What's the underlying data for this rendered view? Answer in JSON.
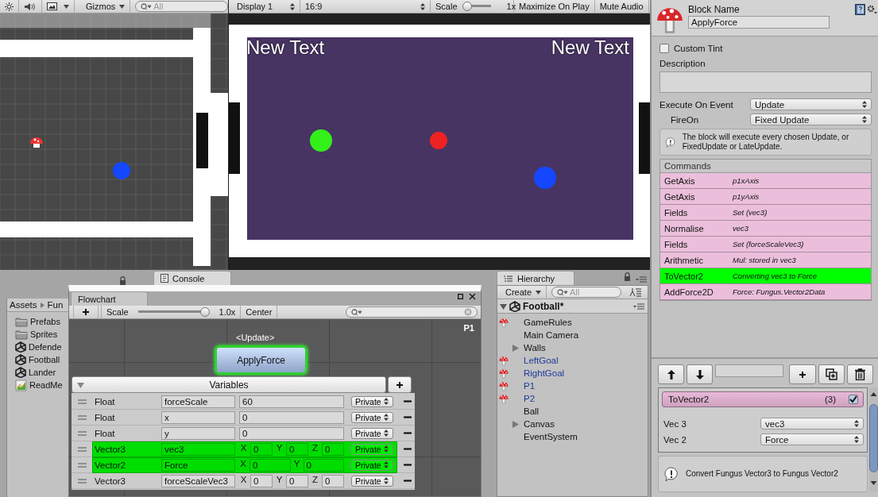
{
  "scene_view": {
    "toolbar": {
      "gizmos": "Gizmos",
      "search": {
        "placeholder": "All"
      }
    }
  },
  "game_view": {
    "toolbar": {
      "display": "Display 1",
      "aspect": "16:9",
      "scale_label": "Scale",
      "scale_reading": "1x",
      "toggles": [
        {
          "label": "Maximize On Play",
          "on": false
        },
        {
          "label": "Mute Audio",
          "on": false
        }
      ]
    },
    "texts": [
      "New Text",
      "New Text"
    ]
  },
  "console_tab": "Console",
  "project": {
    "breadcrumb": [
      "Assets",
      "Fun"
    ],
    "items": [
      {
        "kind": "folder",
        "label": "Prefabs"
      },
      {
        "kind": "folder",
        "label": "Sprites"
      },
      {
        "kind": "scene",
        "label": "Defende"
      },
      {
        "kind": "scene",
        "label": "Football"
      },
      {
        "kind": "scene",
        "label": "Lander"
      },
      {
        "kind": "text",
        "label": "ReadMe"
      }
    ]
  },
  "flowchart": {
    "tab": "Flowchart",
    "toolbar": {
      "scale_label": "Scale",
      "scale": {
        "level": 1.0
      },
      "scale_reading": "1.0x",
      "center_button": "Center"
    },
    "canvas_label": "P1",
    "block": {
      "event": "<Update>",
      "name": "ApplyForce",
      "selected": true
    },
    "variables": {
      "title": "Variables",
      "expanded": true,
      "rows": [
        {
          "kind": "scalar",
          "type": "Float",
          "name": "forceScale",
          "value": "60",
          "access": "Private",
          "highlighted": false
        },
        {
          "kind": "scalar",
          "type": "Float",
          "name": "x",
          "value": "0",
          "access": "Private",
          "highlighted": false
        },
        {
          "kind": "scalar",
          "type": "Float",
          "name": "y",
          "value": "0",
          "access": "Private",
          "highlighted": false
        },
        {
          "kind": "vector",
          "type": "Vector3",
          "name": "vec3",
          "components": [
            {
              "axis": "X",
              "value": "0"
            },
            {
              "axis": "Y",
              "value": "0"
            },
            {
              "axis": "Z",
              "value": "0"
            }
          ],
          "access": "Private",
          "highlighted": true
        },
        {
          "kind": "vector",
          "type": "Vector2",
          "name": "Force",
          "components": [
            {
              "axis": "X",
              "value": "0"
            },
            {
              "axis": "Y",
              "value": "0"
            }
          ],
          "access": "Private",
          "highlighted": true
        },
        {
          "kind": "vector",
          "type": "Vector3",
          "name": "forceScaleVec3",
          "components": [
            {
              "axis": "X",
              "value": "0"
            },
            {
              "axis": "Y",
              "value": "0"
            },
            {
              "axis": "Z",
              "value": "0"
            }
          ],
          "access": "Private",
          "highlighted": false
        }
      ]
    }
  },
  "hierarchy": {
    "tab": "Hierarchy",
    "create": "Create",
    "search": {
      "placeholder": "All"
    },
    "scene": {
      "name": "Football*",
      "expanded": true,
      "items": [
        {
          "label": "GameRules",
          "kind": "flowchart",
          "prefab": false
        },
        {
          "label": "Main Camera",
          "kind": "object",
          "prefab": false
        },
        {
          "label": "Walls",
          "kind": "object",
          "prefab": false,
          "expanded": false
        },
        {
          "label": "LeftGoal",
          "kind": "flowchart",
          "prefab": true
        },
        {
          "label": "RightGoal",
          "kind": "flowchart",
          "prefab": true
        },
        {
          "label": "P1",
          "kind": "flowchart",
          "prefab": true
        },
        {
          "label": "P2",
          "kind": "flowchart",
          "prefab": true
        },
        {
          "label": "Ball",
          "kind": "object",
          "prefab": false
        },
        {
          "label": "Canvas",
          "kind": "object",
          "prefab": false,
          "expanded": false
        },
        {
          "label": "EventSystem",
          "kind": "object",
          "prefab": false
        }
      ]
    }
  },
  "inspector": {
    "name_label": "Block Name",
    "block_name": "ApplyForce",
    "custom_tint": {
      "label": "Custom Tint",
      "checked": false
    },
    "description_label": "Description",
    "fields": [
      {
        "label": "Execute On Event",
        "value": "Update",
        "children": [
          {
            "label": "FireOn",
            "value": "Fixed Update"
          }
        ]
      }
    ],
    "help": "The block will execute every chosen Update, or FixedUpdate or LateUpdate.",
    "commands": {
      "title": "Commands",
      "items": [
        {
          "name": "GetAxis",
          "summary": "p1xAxis",
          "selected": false
        },
        {
          "name": "GetAxis",
          "summary": "p1yAxis",
          "selected": false
        },
        {
          "name": "Fields",
          "summary": "Set (vec3)",
          "selected": false
        },
        {
          "name": "Normalise",
          "summary": "vec3",
          "selected": false
        },
        {
          "name": "Fields",
          "summary": "Set (forceScaleVec3)",
          "selected": false
        },
        {
          "name": "Arithmetic",
          "summary": "Mul: stored in vec3",
          "selected": false
        },
        {
          "name": "ToVector2",
          "summary": "Converting vec3 to Force",
          "selected": true
        },
        {
          "name": "AddForce2D",
          "summary": "Force: Fungus.Vector2Data",
          "selected": false
        }
      ]
    },
    "command_editor": {
      "name": "ToVector2",
      "index": "(3)",
      "enabled": true,
      "properties": [
        {
          "label": "Vec 3",
          "value": "vec3"
        },
        {
          "label": "Vec 2",
          "value": "Force"
        }
      ],
      "help": "Convert Fungus Vector3 to Fungus Vector2"
    }
  }
}
